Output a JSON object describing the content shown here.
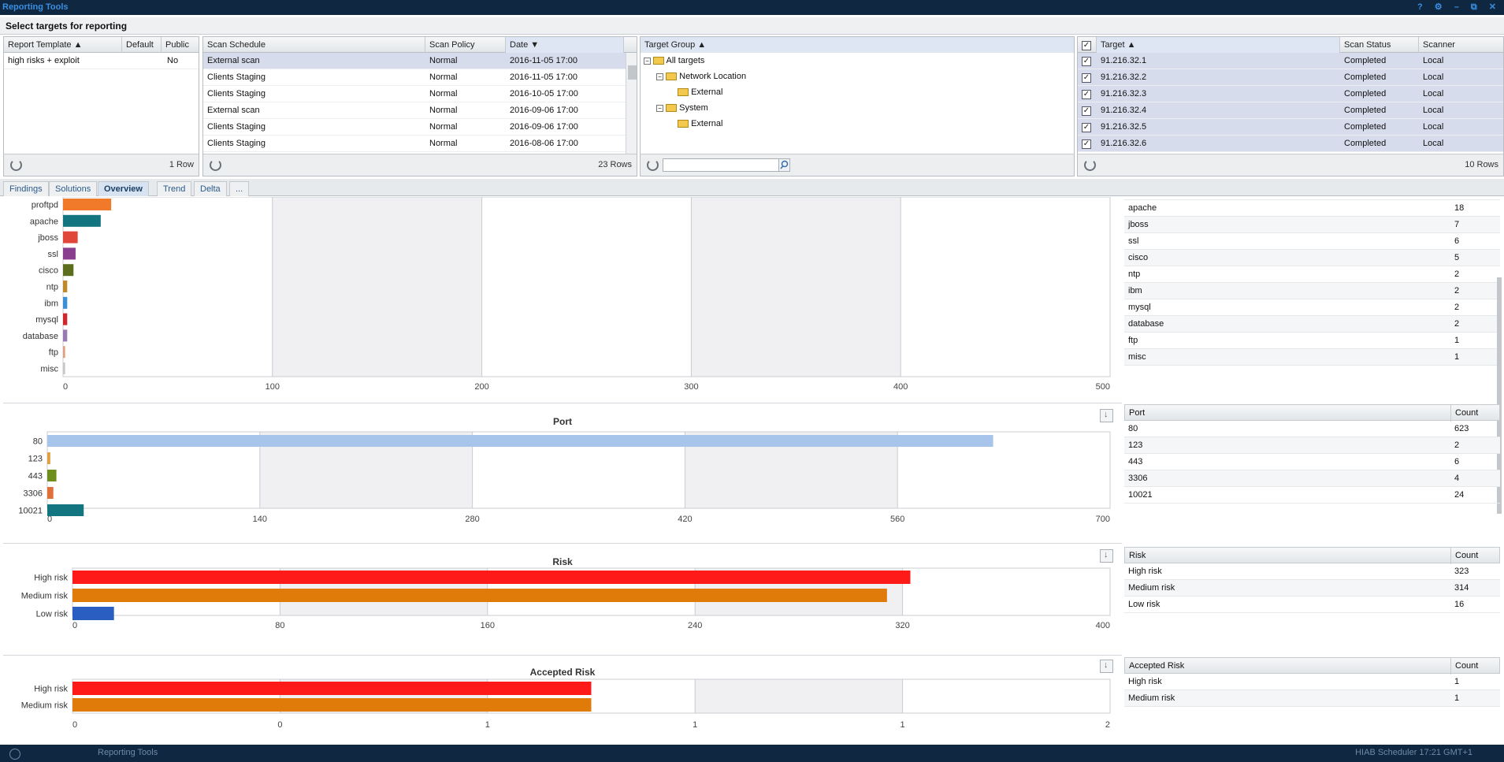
{
  "app": {
    "title": "Reporting Tools",
    "window_controls": "? ⚙ – ⧉ ✕"
  },
  "select_bar": {
    "label": "Select targets for reporting"
  },
  "report_template": {
    "headers": [
      "Report Template ▲",
      "Default",
      "Public"
    ],
    "rows": [
      {
        "name": "high risks + exploit",
        "default": "",
        "public": "No"
      }
    ],
    "footer": "1 Row"
  },
  "scan_schedule": {
    "headers": [
      "Scan Schedule",
      "Scan Policy",
      "Date ▼"
    ],
    "rows": [
      {
        "schedule": "External scan",
        "policy": "Normal",
        "date": "2016-11-05 17:00"
      },
      {
        "schedule": "Clients Staging",
        "policy": "Normal",
        "date": "2016-11-05 17:00"
      },
      {
        "schedule": "Clients Staging",
        "policy": "Normal",
        "date": "2016-10-05 17:00"
      },
      {
        "schedule": "External scan",
        "policy": "Normal",
        "date": "2016-09-06 17:00"
      },
      {
        "schedule": "Clients Staging",
        "policy": "Normal",
        "date": "2016-09-06 17:00"
      },
      {
        "schedule": "Clients Staging",
        "policy": "Normal",
        "date": "2016-08-06 17:00"
      }
    ],
    "footer": "23 Rows"
  },
  "target_group": {
    "header": "Target Group ▲",
    "tree": [
      "All targets",
      "Network Location",
      "External",
      "System",
      "External"
    ],
    "search_placeholder": ""
  },
  "targets": {
    "headers": [
      "Target ▲",
      "Scan Status",
      "Scanner"
    ],
    "rows": [
      {
        "target": "91.216.32.1",
        "status": "Completed",
        "scanner": "Local"
      },
      {
        "target": "91.216.32.2",
        "status": "Completed",
        "scanner": "Local"
      },
      {
        "target": "91.216.32.3",
        "status": "Completed",
        "scanner": "Local"
      },
      {
        "target": "91.216.32.4",
        "status": "Completed",
        "scanner": "Local"
      },
      {
        "target": "91.216.32.5",
        "status": "Completed",
        "scanner": "Local"
      },
      {
        "target": "91.216.32.6",
        "status": "Completed",
        "scanner": "Local"
      }
    ],
    "footer": "10 Rows",
    "check": "✓"
  },
  "tabs": [
    "Findings",
    "Solutions",
    "Overview",
    "Trend",
    "Delta",
    "..."
  ],
  "colors": {
    "accent": "#1a3f66",
    "high": "#ff1a1a",
    "medium": "#e07b0a",
    "low": "#2a5ec0",
    "port_main": "#a7c5ea"
  },
  "tables": {
    "product": {
      "truncated_label": "proftpd",
      "rows": [
        {
          "label": "apache",
          "count": "18"
        },
        {
          "label": "jboss",
          "count": "7"
        },
        {
          "label": "ssl",
          "count": "6"
        },
        {
          "label": "cisco",
          "count": "5"
        },
        {
          "label": "ntp",
          "count": "2"
        },
        {
          "label": "ibm",
          "count": "2"
        },
        {
          "label": "mysql",
          "count": "2"
        },
        {
          "label": "database",
          "count": "2"
        },
        {
          "label": "ftp",
          "count": "1"
        },
        {
          "label": "misc",
          "count": "1"
        }
      ]
    },
    "port": {
      "headers": [
        "Port",
        "Count"
      ],
      "rows": [
        {
          "label": "80",
          "count": "623"
        },
        {
          "label": "123",
          "count": "2"
        },
        {
          "label": "443",
          "count": "6"
        },
        {
          "label": "3306",
          "count": "4"
        },
        {
          "label": "10021",
          "count": "24"
        }
      ]
    },
    "risk": {
      "headers": [
        "Risk",
        "Count"
      ],
      "rows": [
        {
          "label": "High risk",
          "count": "323"
        },
        {
          "label": "Medium risk",
          "count": "314"
        },
        {
          "label": "Low risk",
          "count": "16"
        }
      ]
    },
    "accepted": {
      "headers": [
        "Accepted Risk",
        "Count"
      ],
      "rows": [
        {
          "label": "High risk",
          "count": "1"
        },
        {
          "label": "Medium risk",
          "count": "1"
        }
      ]
    }
  },
  "chart_data": [
    {
      "type": "bar",
      "title": "",
      "categories": [
        "proftpd",
        "apache",
        "jboss",
        "ssl",
        "cisco",
        "ntp",
        "ibm",
        "mysql",
        "database",
        "ftp",
        "misc"
      ],
      "values": [
        23,
        18,
        7,
        6,
        5,
        2,
        2,
        2,
        2,
        1,
        1
      ],
      "colors": [
        "#f07a2a",
        "#13757f",
        "#e0463a",
        "#8a3e8e",
        "#5c6e1e",
        "#c08a2a",
        "#3a8fd6",
        "#d0282a",
        "#9a7ab5",
        "#e0a080",
        "#c8c8c8"
      ],
      "xlim": [
        0,
        500
      ],
      "xticks": [
        "0",
        "100",
        "200",
        "300",
        "400",
        "500"
      ]
    },
    {
      "type": "bar",
      "title": "Port",
      "categories": [
        "80",
        "123",
        "443",
        "3306",
        "10021"
      ],
      "values": [
        623,
        2,
        6,
        4,
        24
      ],
      "colors": [
        "#a7c5ea",
        "#e0a040",
        "#6e8e1e",
        "#e0703a",
        "#13757f"
      ],
      "xlim": [
        0,
        700
      ],
      "xticks": [
        "0",
        "140",
        "280",
        "420",
        "560",
        "700"
      ]
    },
    {
      "type": "bar",
      "title": "Risk",
      "categories": [
        "High risk",
        "Medium risk",
        "Low risk"
      ],
      "values": [
        323,
        314,
        16
      ],
      "colors": [
        "#ff1a1a",
        "#e07b0a",
        "#2a5ec0"
      ],
      "xlim": [
        0,
        400
      ],
      "xticks": [
        "0",
        "80",
        "160",
        "240",
        "320",
        "400"
      ]
    },
    {
      "type": "bar",
      "title": "Accepted Risk",
      "categories": [
        "High risk",
        "Medium risk"
      ],
      "values": [
        1,
        1
      ],
      "colors": [
        "#ff1a1a",
        "#e07b0a"
      ],
      "xlim": [
        0,
        2
      ],
      "xticks": [
        "0",
        "0",
        "1",
        "1",
        "1",
        "2"
      ]
    }
  ],
  "status_bar": {
    "left": "Reporting Tools",
    "right": "HIAB   Scheduler   17:21 GMT+1"
  }
}
